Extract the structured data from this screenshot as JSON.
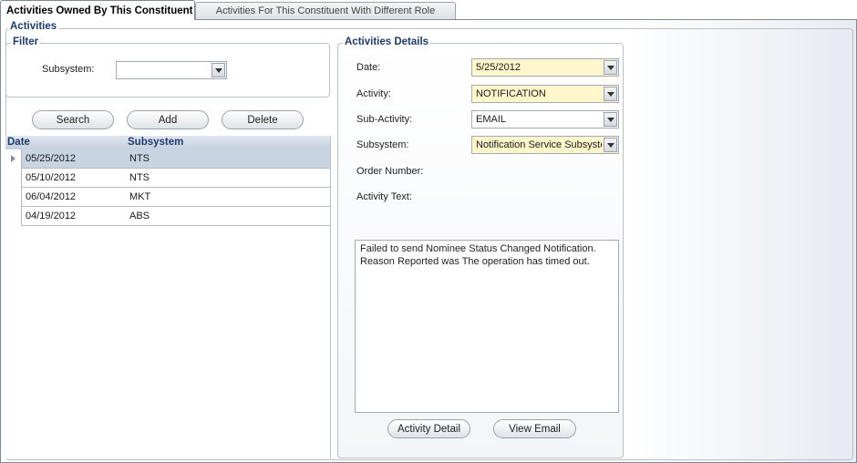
{
  "tabs": [
    {
      "label": "Activities Owned By This Constituent"
    },
    {
      "label": "Activities For This Constituent With Different Role"
    }
  ],
  "activities_title": "Activities",
  "filter": {
    "title": "Filter",
    "subsystem_label": "Subsystem:",
    "subsystem_value": ""
  },
  "buttons": {
    "search": "Search",
    "add": "Add",
    "delete": "Delete"
  },
  "grid": {
    "columns": [
      "Date",
      "Subsystem"
    ],
    "rows": [
      {
        "date": "05/25/2012",
        "subsystem": "NTS"
      },
      {
        "date": "05/10/2012",
        "subsystem": "NTS"
      },
      {
        "date": "06/04/2012",
        "subsystem": "MKT"
      },
      {
        "date": "04/19/2012",
        "subsystem": "ABS"
      }
    ]
  },
  "details": {
    "title": "Activities Details",
    "date_label": "Date:",
    "date_value": "5/25/2012",
    "activity_label": "Activity:",
    "activity_value": "NOTIFICATION",
    "subactivity_label": "Sub-Activity:",
    "subactivity_value": "EMAIL",
    "subsystem_label": "Subsystem:",
    "subsystem_value": "Notification Service Subsystem",
    "order_number_label": "Order Number:",
    "activity_text_label": "Activity Text:",
    "activity_text": "Failed to send Nominee Status Changed Notification.\nReason Reported was The operation has timed out.",
    "activity_detail_button": "Activity Detail",
    "view_email_button": "View Email"
  },
  "colors": {
    "accent": "#1f3a6e",
    "required_field": "#fff6cc",
    "selected_row": "#c9d4e3"
  }
}
